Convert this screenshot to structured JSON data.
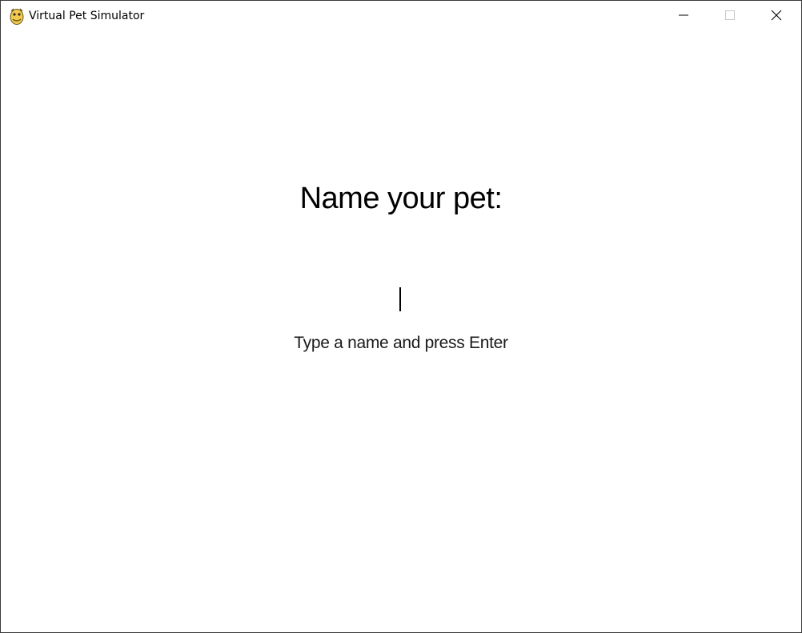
{
  "window": {
    "title": "Virtual Pet Simulator",
    "icon": "python-snake-icon",
    "controls": {
      "minimize": "minimize-icon",
      "maximize": "maximize-icon",
      "close": "close-icon"
    }
  },
  "naming_screen": {
    "heading": "Name your pet:",
    "input_value": "",
    "hint": "Type a name and press Enter"
  },
  "colors": {
    "background": "#ffffff",
    "text": "#000000",
    "icon_yellow": "#f2c94c"
  }
}
